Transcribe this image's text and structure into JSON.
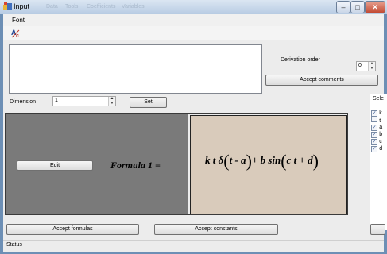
{
  "window": {
    "title": "Input",
    "ghost_menu": [
      "Data",
      "Tools",
      "Coefficients",
      "Variables"
    ],
    "buttons": {
      "minimize": "–",
      "maximize": "□",
      "close": "✕"
    }
  },
  "menu": {
    "font_label": "Font"
  },
  "toolbar": {
    "icon": "font-icon"
  },
  "derivation": {
    "label": "Derivation order",
    "value": "0"
  },
  "comments": {
    "accept_label": "Accept comments",
    "text": ""
  },
  "dimension": {
    "label": "Dimension",
    "value": "1",
    "set_label": "Set"
  },
  "formula": {
    "edit_label": "Edit",
    "name": "Formula 1 =",
    "expression": {
      "part1": "k t δ",
      "arg1": "t - a",
      "plus": "+",
      "part2": "b  sin",
      "arg2": "c t + d"
    }
  },
  "constants_list": {
    "header": "Sele",
    "items": [
      {
        "label": "k",
        "checked": true
      },
      {
        "label": "t",
        "checked": false
      },
      {
        "label": "a",
        "checked": true
      },
      {
        "label": "b",
        "checked": true
      },
      {
        "label": "c",
        "checked": true
      },
      {
        "label": "d",
        "checked": true
      }
    ]
  },
  "bottom": {
    "accept_formulas_label": "Accept formulas",
    "accept_constants_label": "Accept constants"
  },
  "status": {
    "text": "Status"
  }
}
